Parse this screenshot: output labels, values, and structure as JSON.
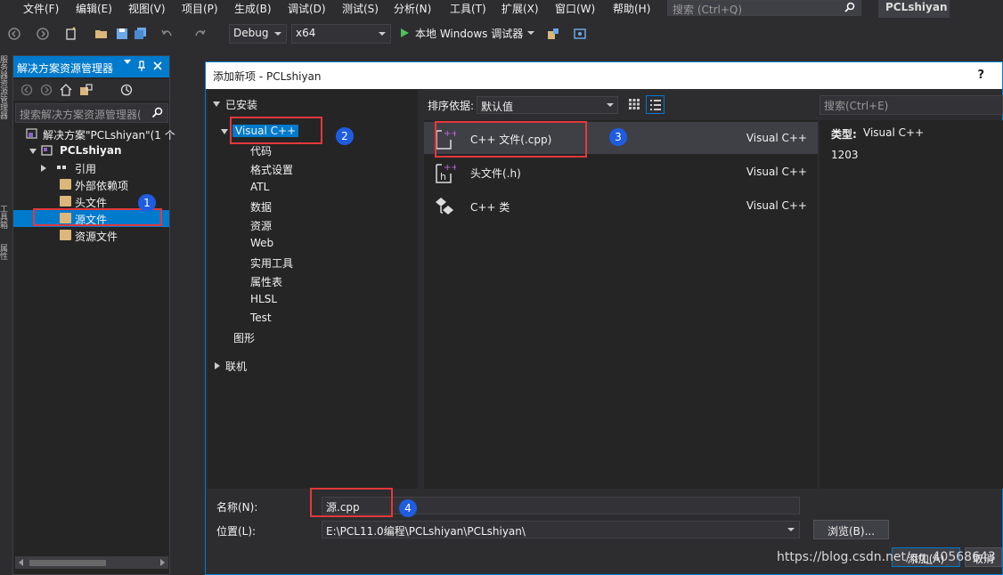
{
  "menu": [
    "文件(F)",
    "编辑(E)",
    "视图(V)",
    "项目(P)",
    "生成(B)",
    "调试(D)",
    "测试(S)",
    "分析(N)",
    "工具(T)",
    "扩展(X)",
    "窗口(W)",
    "帮助(H)"
  ],
  "quick_launch": {
    "placeholder": "搜索 (Ctrl+Q)",
    "icon": "search-icon"
  },
  "project_title": "PCLshiyan",
  "toolbar": {
    "config": "Debug",
    "platform": "x64",
    "run_label": "本地 Windows 调试器"
  },
  "left_strip": [
    "服务器资源管理器",
    "工具箱",
    "属性"
  ],
  "solution_explorer": {
    "title": "解决方案资源管理器",
    "search_placeholder": "搜索解决方案资源管理器(",
    "tree": {
      "solution": "解决方案\"PCLshiyan\"(1 个",
      "project": "PCLshiyan",
      "references": "引用",
      "external": "外部依赖项",
      "headers": "头文件",
      "sources": "源文件",
      "resources": "资源文件"
    }
  },
  "dialog": {
    "title": "添加新项 - PCLshiyan",
    "help": "?",
    "installed": "已安装",
    "categories": [
      "Visual C++",
      "代码",
      "格式设置",
      "ATL",
      "数据",
      "资源",
      "Web",
      "实用工具",
      "属性表",
      "HLSL",
      "Test",
      "图形"
    ],
    "online": "联机",
    "sort_label": "排序依据:",
    "sort_value": "默认值",
    "search_placeholder": "搜索(Ctrl+E)",
    "templates": [
      {
        "name": "C++ 文件(.cpp)",
        "lang": "Visual C++"
      },
      {
        "name": "头文件(.h)",
        "lang": "Visual C++"
      },
      {
        "name": "C++ 类",
        "lang": "Visual C++"
      }
    ],
    "detail": {
      "type_label": "类型:",
      "type_value": "Visual C++",
      "id": "1203"
    },
    "name_label": "名称(N):",
    "name_value": "源.cpp",
    "location_label": "位置(L):",
    "location_value": "E:\\PCL11.0编程\\PCLshiyan\\PCLshiyan\\",
    "browse": "浏览(B)...",
    "add": "添加(A)",
    "cancel": "取消"
  },
  "badges": [
    "1",
    "2",
    "3",
    "4"
  ],
  "watermark": "https://blog.csdn.net/qq_40568643",
  "colors": {
    "accent": "#007acc",
    "highlight_box": "#e5383b",
    "badge": "#1f5de0",
    "folder": "#dcb67a"
  }
}
